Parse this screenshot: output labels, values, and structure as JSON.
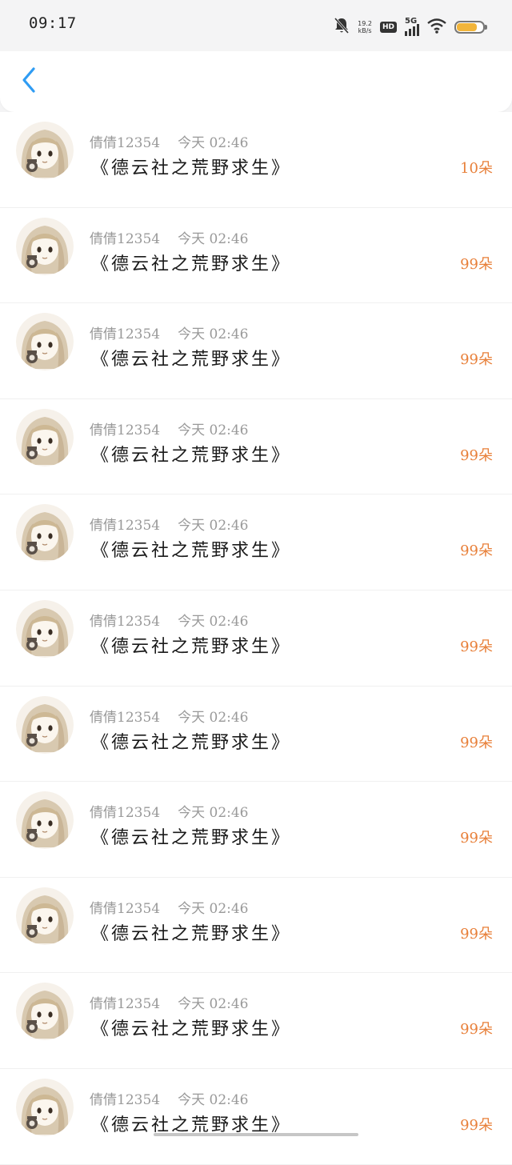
{
  "status_bar": {
    "time": "09:17",
    "net_speed_value": "19.2",
    "net_speed_unit": "kB/s",
    "hd_label": "HD",
    "network_label": "5G",
    "battery_level": 0.8,
    "battery_color": "#f2b53b",
    "icons": [
      "bell-off-icon",
      "signal-icon",
      "wifi-icon",
      "battery-icon"
    ]
  },
  "nav": {
    "back_icon": "chevron-left-icon",
    "accent": "#2f9cf3"
  },
  "list": {
    "items": [
      {
        "user": "倩倩12354",
        "time": "今天 02:46",
        "title": "《德云社之荒野求生》",
        "amount": "10朵"
      },
      {
        "user": "倩倩12354",
        "time": "今天 02:46",
        "title": "《德云社之荒野求生》",
        "amount": "99朵"
      },
      {
        "user": "倩倩12354",
        "time": "今天 02:46",
        "title": "《德云社之荒野求生》",
        "amount": "99朵"
      },
      {
        "user": "倩倩12354",
        "time": "今天 02:46",
        "title": "《德云社之荒野求生》",
        "amount": "99朵"
      },
      {
        "user": "倩倩12354",
        "time": "今天 02:46",
        "title": "《德云社之荒野求生》",
        "amount": "99朵"
      },
      {
        "user": "倩倩12354",
        "time": "今天 02:46",
        "title": "《德云社之荒野求生》",
        "amount": "99朵"
      },
      {
        "user": "倩倩12354",
        "time": "今天 02:46",
        "title": "《德云社之荒野求生》",
        "amount": "99朵"
      },
      {
        "user": "倩倩12354",
        "time": "今天 02:46",
        "title": "《德云社之荒野求生》",
        "amount": "99朵"
      },
      {
        "user": "倩倩12354",
        "time": "今天 02:46",
        "title": "《德云社之荒野求生》",
        "amount": "99朵"
      },
      {
        "user": "倩倩12354",
        "time": "今天 02:46",
        "title": "《德云社之荒野求生》",
        "amount": "99朵"
      },
      {
        "user": "倩倩12354",
        "time": "今天 02:46",
        "title": "《德云社之荒野求生》",
        "amount": "99朵"
      }
    ],
    "amount_color": "#e8803a"
  }
}
